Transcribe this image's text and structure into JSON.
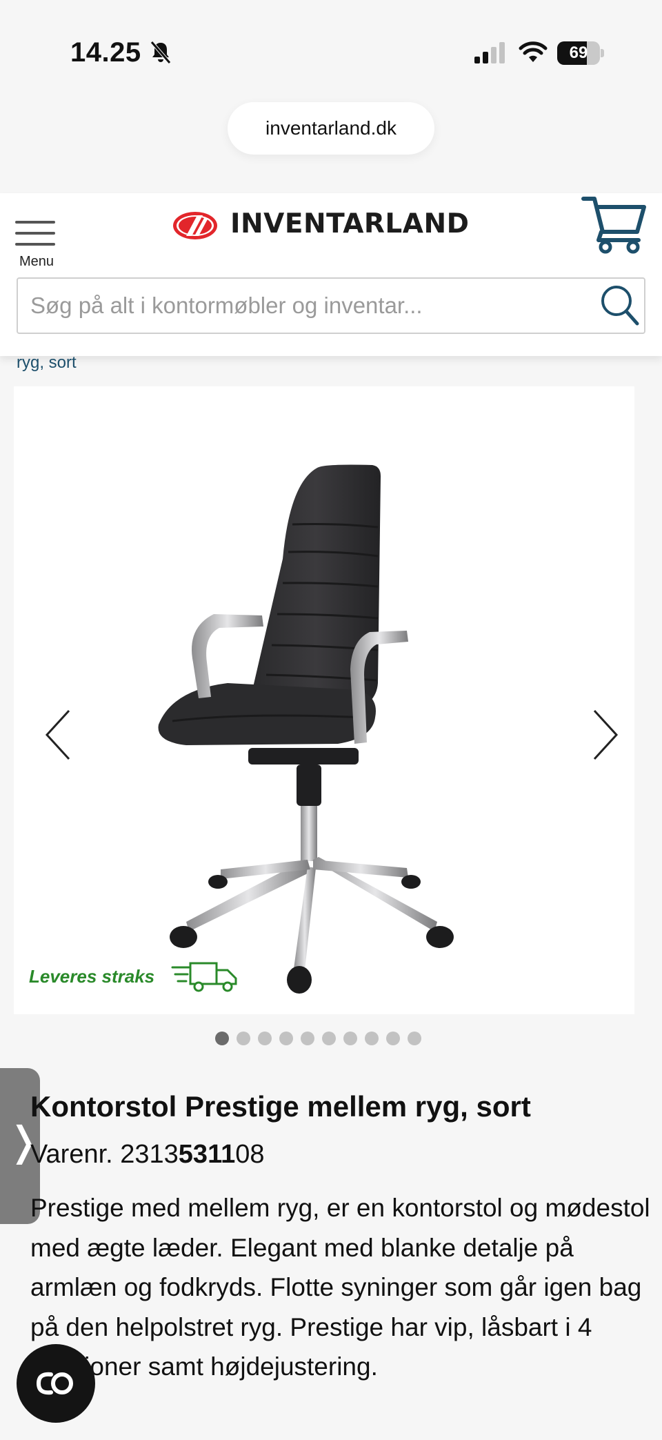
{
  "status_bar": {
    "time": "14.25",
    "battery": "69",
    "battery_level": 0.69
  },
  "browser": {
    "url": "inventarland.dk"
  },
  "header": {
    "menu_label": "Menu",
    "logo_text": "INVENTARLAND",
    "search_placeholder": "Søg på alt i kontormøbler og inventar..."
  },
  "breadcrumb": {
    "current": "ryg, sort"
  },
  "gallery": {
    "delivery_badge": "Leveres straks",
    "image_count": 10,
    "active_index": 0
  },
  "product": {
    "title": "Kontorstol Prestige mellem ryg, sort",
    "sku_label": "Varenr. 2313",
    "sku_bold": "5311",
    "sku_suffix": "08",
    "description": "Prestige med mellem ryg, er en kontorstol og mødestol med ægte læder. Elegant med blanke detalje på armlæn og fodkryds. Flotte syninger som går igen bag på den helpolstret ryg. Prestige har vip, låsbart i 4 positioner samt højdejustering."
  },
  "side_tab": {
    "glyph": "❭"
  },
  "colors": {
    "brand_red": "#e2262b",
    "link_blue": "#1d4f6b",
    "cart_blue": "#1d4f6b",
    "delivery_green": "#2a8a2a"
  }
}
